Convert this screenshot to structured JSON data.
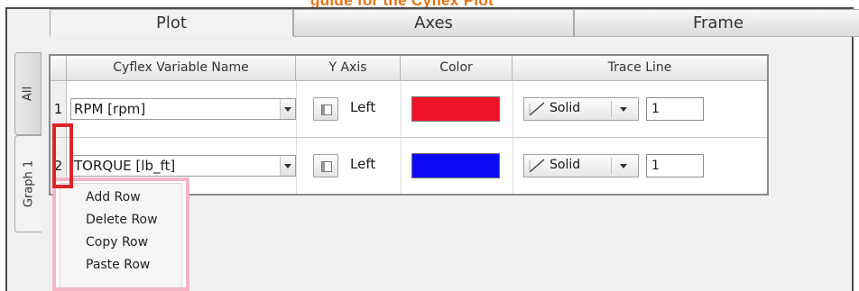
{
  "header_cut_text": "guide for the Cyflex Plot",
  "tabs": [
    {
      "label": "Plot",
      "active": true
    },
    {
      "label": "Axes",
      "active": false
    },
    {
      "label": "Frame",
      "active": false
    }
  ],
  "side_tabs": [
    {
      "label": "All",
      "active": false
    },
    {
      "label": "Graph 1",
      "active": true
    }
  ],
  "table": {
    "columns": [
      "Cyflex Variable Name",
      "Y Axis",
      "Color",
      "Trace Line"
    ],
    "rows": [
      {
        "index": "1",
        "variable": "RPM [rpm]",
        "y_axis": "Left",
        "color": "#f0142a",
        "line_style": "Solid",
        "line_width": "1"
      },
      {
        "index": "2",
        "variable": "TORQUE [lb_ft]",
        "y_axis": "Left",
        "color": "#0a0af5",
        "line_style": "Solid",
        "line_width": "1"
      }
    ]
  },
  "context_menu": {
    "items": [
      "Add Row",
      "Delete Row",
      "Copy Row",
      "Paste Row"
    ]
  },
  "colors": {
    "highlight_box": "#e0222a",
    "menu_highlight": "#f4b6c6",
    "title_accent": "#e8720c"
  }
}
